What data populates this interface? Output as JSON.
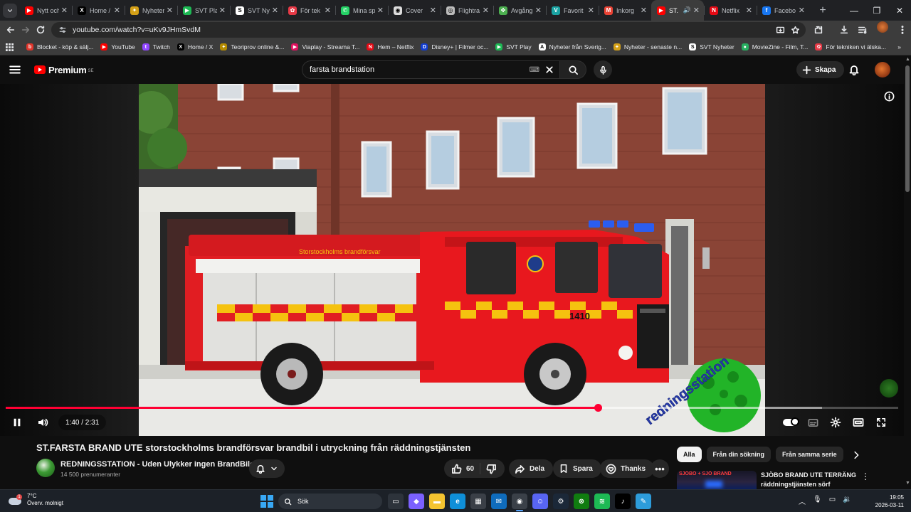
{
  "browser": {
    "tabs": [
      {
        "title": "Nytt och",
        "favicon": "youtube-icon",
        "color": "#ff0000",
        "glyph": "▶"
      },
      {
        "title": "Home / X",
        "favicon": "x-icon",
        "color": "#000000",
        "glyph": "X"
      },
      {
        "title": "Nyheter",
        "favicon": "news-icon",
        "color": "#d4a017",
        "glyph": "✦"
      },
      {
        "title": "SVT Play",
        "favicon": "svtplay-icon",
        "color": "#1db954",
        "glyph": "▶"
      },
      {
        "title": "SVT Ny",
        "favicon": "svt-icon",
        "color": "#ffffff",
        "glyph": "S"
      },
      {
        "title": "För tek",
        "favicon": "tech-icon",
        "color": "#e63946",
        "glyph": "✿"
      },
      {
        "title": "Mina sp",
        "favicon": "whatsapp-icon",
        "color": "#25d366",
        "glyph": "✆"
      },
      {
        "title": "Cover",
        "favicon": "circle-icon",
        "color": "#dddddd",
        "glyph": "◉"
      },
      {
        "title": "Flightra",
        "favicon": "globe-icon",
        "color": "#bbbbbb",
        "glyph": "◎"
      },
      {
        "title": "Avgång",
        "favicon": "leaf-icon",
        "color": "#4caf50",
        "glyph": "✤"
      },
      {
        "title": "Favorit",
        "favicon": "v-icon",
        "color": "#1aa3a3",
        "glyph": "V"
      },
      {
        "title": "Inkorg",
        "favicon": "gmail-icon",
        "color": "#ea4335",
        "glyph": "M"
      },
      {
        "title": "ST.",
        "favicon": "youtube-icon",
        "color": "#ff0000",
        "glyph": "▶",
        "active": true,
        "audio": "🔊"
      },
      {
        "title": "Netflix",
        "favicon": "netflix-icon",
        "color": "#e50914",
        "glyph": "N"
      },
      {
        "title": "Facebo",
        "favicon": "facebook-icon",
        "color": "#1877f2",
        "glyph": "f"
      }
    ],
    "new_tab": "+",
    "url": "youtube.com/watch?v=uKv9JHmSvdM",
    "bookmarks": [
      {
        "label": "Blocket - köp & sälj...",
        "color": "#e0352b",
        "glyph": "b"
      },
      {
        "label": "YouTube",
        "color": "#ff0000",
        "glyph": "▶"
      },
      {
        "label": "Twitch",
        "color": "#9146ff",
        "glyph": "t"
      },
      {
        "label": "Home / X",
        "color": "#000000",
        "glyph": "X"
      },
      {
        "label": "Teoriprov online &...",
        "color": "#b58b00",
        "glyph": "✦"
      },
      {
        "label": "Viaplay - Streama T...",
        "color": "#e0115f",
        "glyph": "▶"
      },
      {
        "label": "Hem – Netflix",
        "color": "#e50914",
        "glyph": "N"
      },
      {
        "label": "Disney+ | Filmer oc...",
        "color": "#113ccf",
        "glyph": "D"
      },
      {
        "label": "SVT Play",
        "color": "#1db954",
        "glyph": "▶"
      },
      {
        "label": "Nyheter från Sverig...",
        "color": "#ffffff",
        "glyph": "A"
      },
      {
        "label": "Nyheter - senaste n...",
        "color": "#d4a017",
        "glyph": "✦"
      },
      {
        "label": "SVT Nyheter",
        "color": "#ffffff",
        "glyph": "S"
      },
      {
        "label": "MovieZine - Film, T...",
        "color": "#27ae60",
        "glyph": "●"
      },
      {
        "label": "För tekniken vi älska...",
        "color": "#e63946",
        "glyph": "✿"
      }
    ]
  },
  "youtube": {
    "logo_text": "Premium",
    "logo_region": "SE",
    "search_query": "farsta brandstation",
    "create_label": "Skapa",
    "player": {
      "time": "1:40 / 2:31",
      "progress": 0.6637,
      "buffered": 0.915,
      "truck_number": "1410",
      "truck_text": "Storstockholms brandförsvar",
      "watermark": "redningsstation"
    },
    "video": {
      "title": "ST.FARSTA BRAND UTE storstockholms brandförsvar brandbil i utryckning från räddningstjänsten",
      "channel": "REDNINGSSTATION - Uden Ulykker ingen BrandBiler",
      "subscribers": "14 500 prenumeranter",
      "likes": "60",
      "share_label": "Dela",
      "save_label": "Spara",
      "thanks_label": "Thanks"
    },
    "sidebar": {
      "chips": [
        "Alla",
        "Från din sökning",
        "Från samma serie"
      ],
      "recommendation": {
        "title": "SJÖBO BRAND UTE TERRÄNG räddningstjänsten sörf brandb...",
        "thumb_text": "SJÖBO + SJÖ BRAND"
      }
    }
  },
  "taskbar": {
    "weather_temp": "7°C",
    "weather_desc": "Överv. molnigt",
    "search_label": "Sök",
    "apps": [
      {
        "name": "taskview-icon",
        "color": "#2d333b",
        "glyph": "▭"
      },
      {
        "name": "copilot-icon",
        "color": "#7b61ff",
        "glyph": "◆"
      },
      {
        "name": "file-explorer-icon",
        "color": "#f4c430",
        "glyph": "▬"
      },
      {
        "name": "edge-icon",
        "color": "#0f8fd8",
        "glyph": "e"
      },
      {
        "name": "store-icon",
        "color": "#3a3f47",
        "glyph": "▦"
      },
      {
        "name": "mail-icon",
        "color": "#0f6cbd",
        "glyph": "✉"
      },
      {
        "name": "chrome-icon",
        "color": "#2a2f36",
        "glyph": "◉",
        "active": true
      },
      {
        "name": "discord-icon",
        "color": "#5865f2",
        "glyph": "☺"
      },
      {
        "name": "steam-icon",
        "color": "#1b2838",
        "glyph": "⚙"
      },
      {
        "name": "xbox-icon",
        "color": "#107c10",
        "glyph": "⊗"
      },
      {
        "name": "spotify-icon",
        "color": "#1db954",
        "glyph": "≋"
      },
      {
        "name": "tiktok-icon",
        "color": "#000000",
        "glyph": "♪"
      },
      {
        "name": "paint-icon",
        "color": "#2d9cdb",
        "glyph": "✎"
      }
    ],
    "time": "19:05",
    "date": "2026-03-11"
  }
}
